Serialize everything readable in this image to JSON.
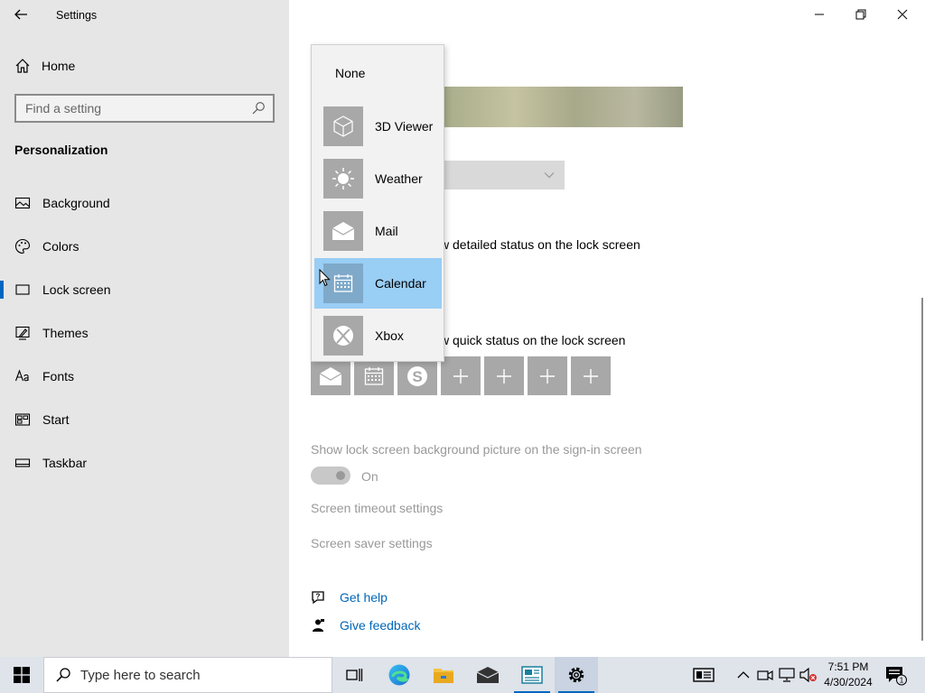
{
  "window": {
    "title": "Settings"
  },
  "sidebar": {
    "home_label": "Home",
    "search_placeholder": "Find a setting",
    "section_title": "Personalization",
    "items": [
      {
        "label": "Background",
        "icon": "image-icon"
      },
      {
        "label": "Colors",
        "icon": "palette-icon"
      },
      {
        "label": "Lock screen",
        "icon": "lock-screen-icon",
        "active": true
      },
      {
        "label": "Themes",
        "icon": "themes-icon"
      },
      {
        "label": "Fonts",
        "icon": "fonts-icon"
      },
      {
        "label": "Start",
        "icon": "start-icon"
      },
      {
        "label": "Taskbar",
        "icon": "taskbar-icon"
      }
    ]
  },
  "content": {
    "detailed_status_text": "w detailed status on the lock screen",
    "quick_status_text": "w quick status on the lock screen",
    "quick_status_apps": [
      "mail-icon",
      "calendar-icon",
      "skype-icon",
      "plus-icon",
      "plus-icon",
      "plus-icon",
      "plus-icon"
    ],
    "signin_label": "Show lock screen background picture on the sign-in screen",
    "toggle_state": "On",
    "screen_timeout_link": "Screen timeout settings",
    "screen_saver_link": "Screen saver settings",
    "get_help": "Get help",
    "give_feedback": "Give feedback"
  },
  "flyout": {
    "none_label": "None",
    "items": [
      {
        "label": "3D Viewer",
        "icon": "cube-icon"
      },
      {
        "label": "Weather",
        "icon": "sun-icon"
      },
      {
        "label": "Mail",
        "icon": "mail-icon"
      },
      {
        "label": "Calendar",
        "icon": "calendar-icon",
        "selected": true
      },
      {
        "label": "Xbox",
        "icon": "xbox-icon"
      }
    ]
  },
  "taskbar": {
    "search_placeholder": "Type here to search",
    "time": "7:51 PM",
    "date": "4/30/2024",
    "notification_count": "1"
  },
  "colors": {
    "accent": "#0067c0",
    "link": "#0067b8",
    "selection": "#99cef5"
  }
}
